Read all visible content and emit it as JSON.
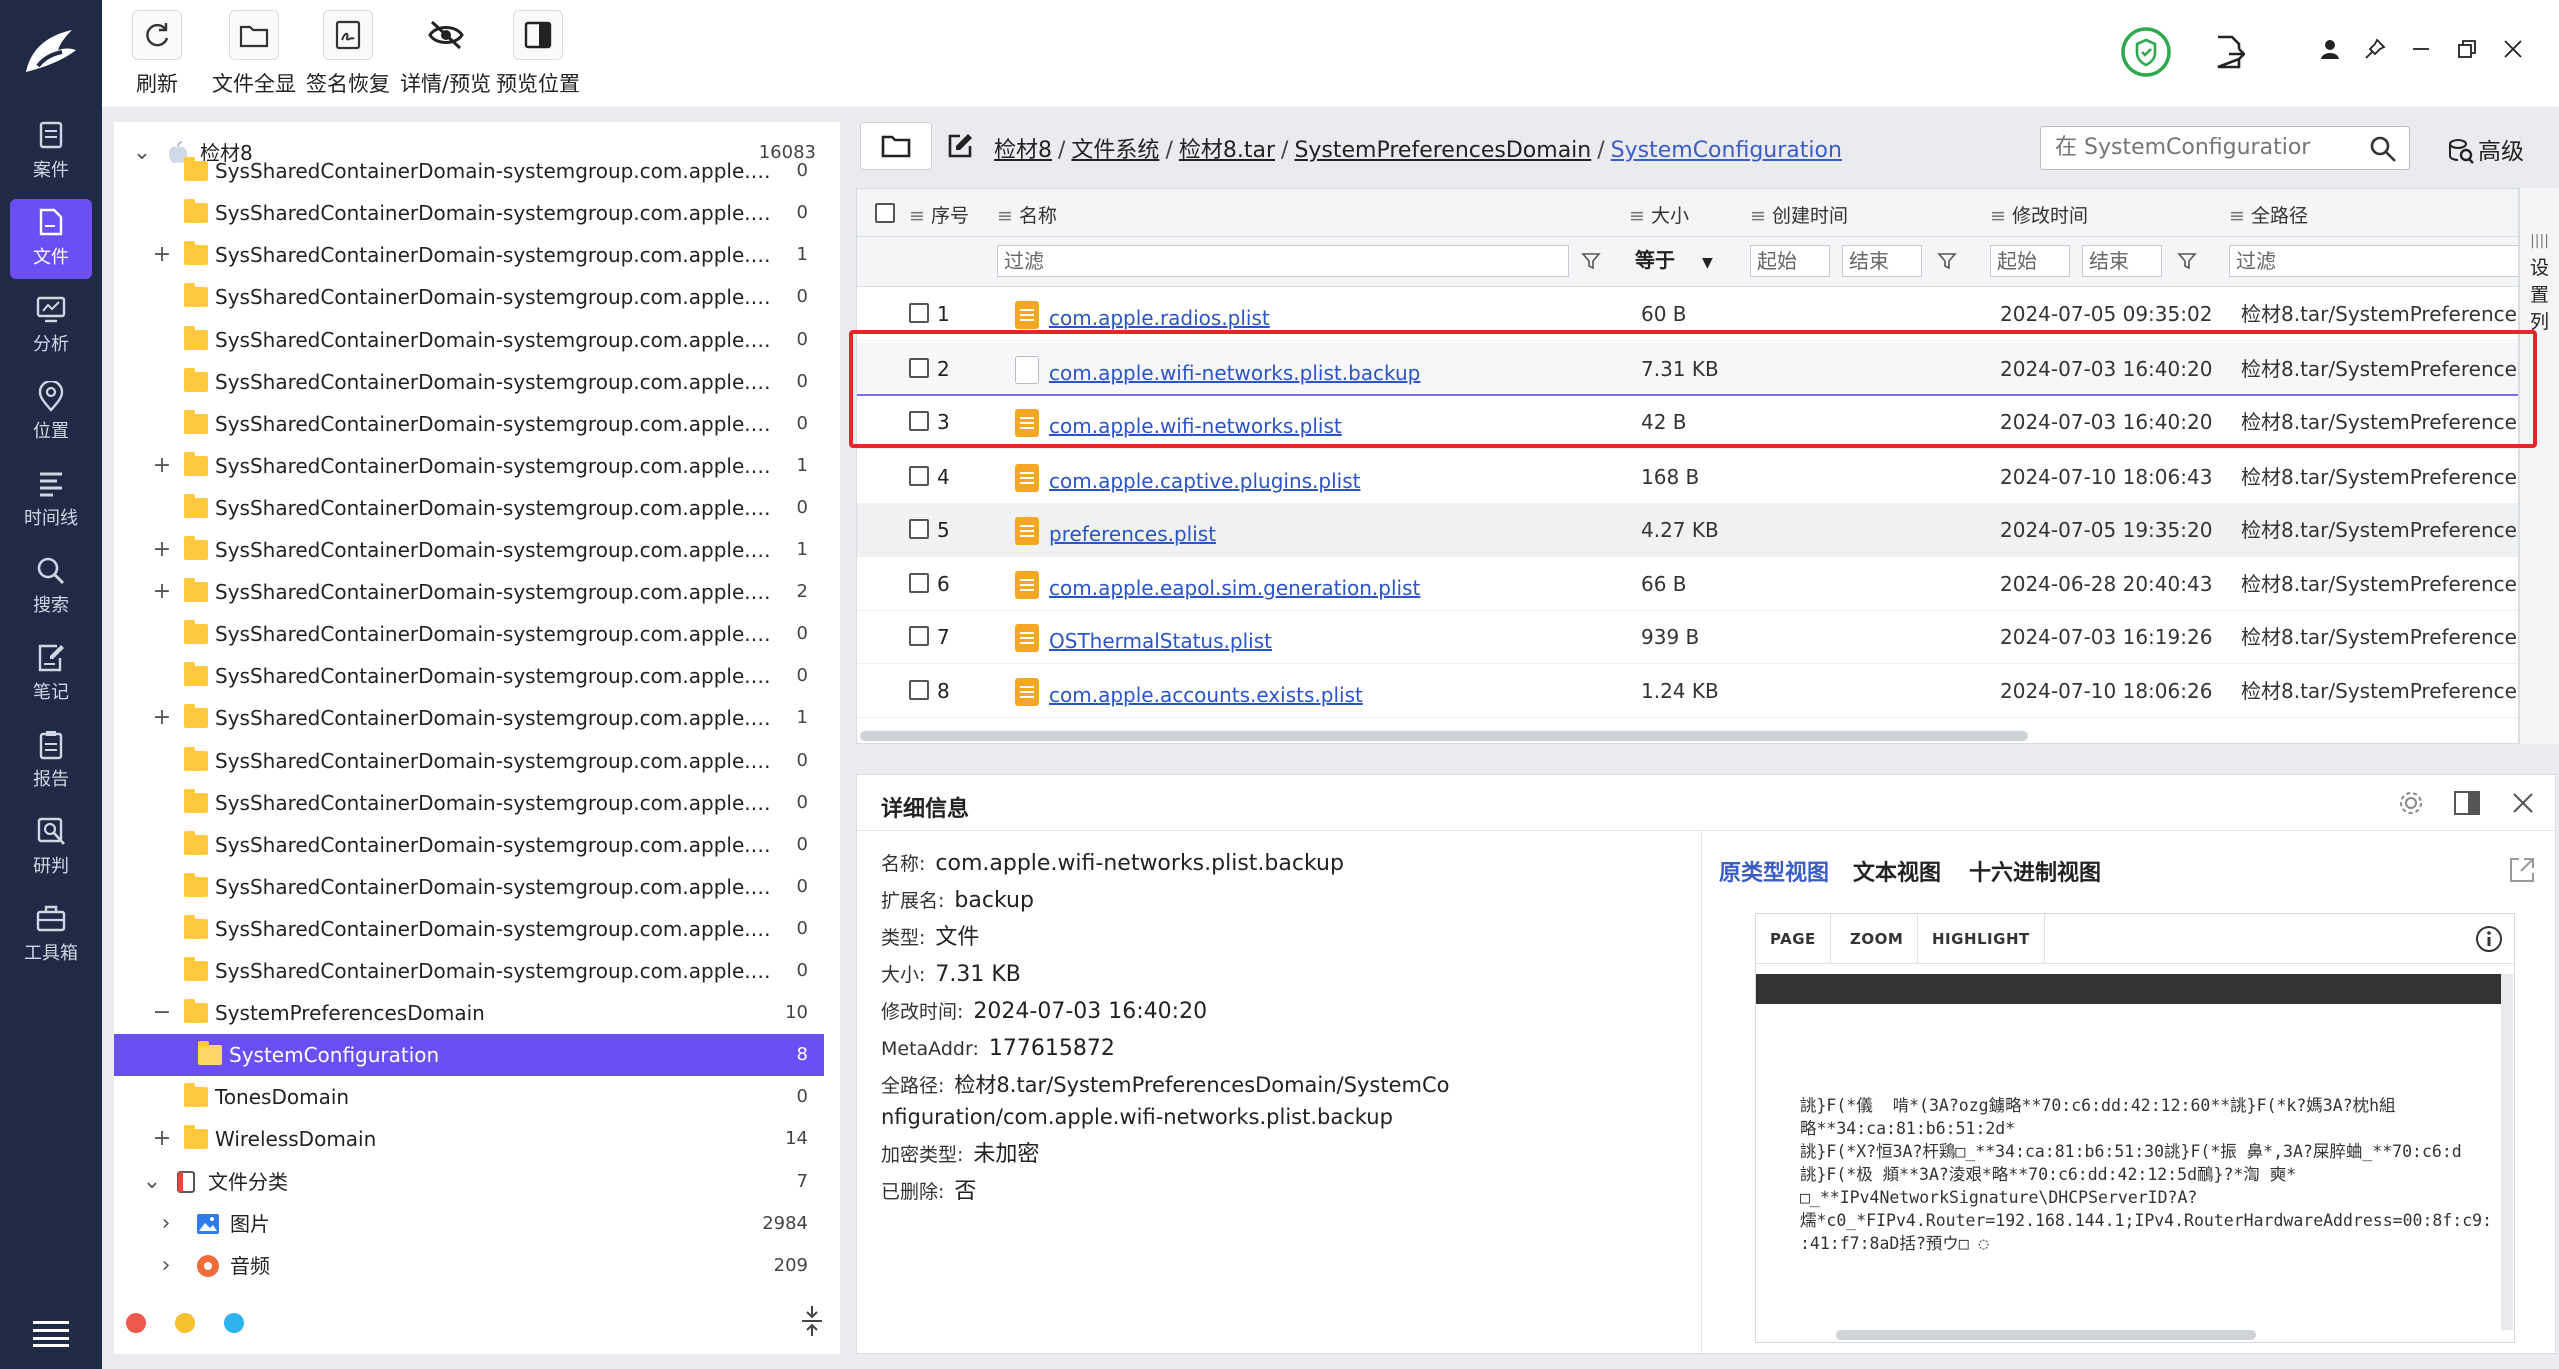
{
  "nav": {
    "items": [
      {
        "label": "案件",
        "icon": "case-icon"
      },
      {
        "label": "文件",
        "icon": "file-icon"
      },
      {
        "label": "分析",
        "icon": "analysis-icon"
      },
      {
        "label": "位置",
        "icon": "location-icon"
      },
      {
        "label": "时间线",
        "icon": "timeline-icon"
      },
      {
        "label": "搜索",
        "icon": "search-icon"
      },
      {
        "label": "笔记",
        "icon": "note-icon"
      },
      {
        "label": "报告",
        "icon": "report-icon"
      },
      {
        "label": "研判",
        "icon": "judge-icon"
      },
      {
        "label": "工具箱",
        "icon": "toolbox-icon"
      }
    ],
    "active_index": 1
  },
  "toolbar": {
    "refresh": "刷新",
    "show_all_files": "文件全显",
    "signature_recovery": "签名恢复",
    "details_preview": "详情/预览",
    "preview_position": "预览位置"
  },
  "tree": {
    "root": {
      "label": "检材8",
      "count": "16083"
    },
    "rows": [
      {
        "label": "SysSharedContainerDomain-systemgroup.com.apple.Devic...",
        "count": "0",
        "exp": ""
      },
      {
        "label": "SysSharedContainerDomain-systemgroup.com.apple.geod",
        "count": "0",
        "exp": ""
      },
      {
        "label": "SysSharedContainerDomain-systemgroup.com.apple.icloud...",
        "count": "1",
        "exp": "+"
      },
      {
        "label": "SysSharedContainerDomain-systemgroup.com.apple.icloud...",
        "count": "0",
        "exp": ""
      },
      {
        "label": "SysSharedContainerDomain-systemgroup.com.apple.icloud...",
        "count": "0",
        "exp": ""
      },
      {
        "label": "SysSharedContainerDomain-systemgroup.com.apple.lsd",
        "count": "0",
        "exp": ""
      },
      {
        "label": "SysSharedContainerDomain-systemgroup.com.apple.lsd.ico...",
        "count": "0",
        "exp": ""
      },
      {
        "label": "SysSharedContainerDomain-systemgroup.com.apple.lskdrl",
        "count": "1",
        "exp": "+"
      },
      {
        "label": "SysSharedContainerDomain-systemgroup.com.apple.media...",
        "count": "0",
        "exp": ""
      },
      {
        "label": "SysSharedContainerDomain-systemgroup.com.apple.media...",
        "count": "1",
        "exp": "+"
      },
      {
        "label": "SysSharedContainerDomain-systemgroup.com.apple.mobil...",
        "count": "2",
        "exp": "+"
      },
      {
        "label": "SysSharedContainerDomain-systemgroup.com.apple.mobil...",
        "count": "0",
        "exp": ""
      },
      {
        "label": "SysSharedContainerDomain-systemgroup.com.apple.nearb...",
        "count": "0",
        "exp": ""
      },
      {
        "label": "SysSharedContainerDomain-systemgroup.com.apple.nsurls...",
        "count": "1",
        "exp": "+"
      },
      {
        "label": "SysSharedContainerDomain-systemgroup.com.apple.onde...",
        "count": "0",
        "exp": ""
      },
      {
        "label": "SysSharedContainerDomain-systemgroup.com.apple.osana...",
        "count": "0",
        "exp": ""
      },
      {
        "label": "SysSharedContainerDomain-systemgroup.com.apple.Repor...",
        "count": "0",
        "exp": ""
      },
      {
        "label": "SysSharedContainerDomain-systemgroup.com.apple.share...",
        "count": "0",
        "exp": ""
      },
      {
        "label": "SysSharedContainerDomain-systemgroup.com.apple.Video...",
        "count": "0",
        "exp": ""
      },
      {
        "label": "SysSharedContainerDomain-systemgroup.com.apple.WiFiA...",
        "count": "0",
        "exp": ""
      },
      {
        "label": "SystemPreferencesDomain",
        "count": "10",
        "exp": "−"
      },
      {
        "label": "SystemConfiguration",
        "count": "8",
        "exp": "",
        "selected": true
      },
      {
        "label": "TonesDomain",
        "count": "0",
        "exp": ""
      },
      {
        "label": "WirelessDomain",
        "count": "14",
        "exp": "+"
      }
    ],
    "category": {
      "label": "文件分类",
      "count": "7"
    },
    "cat_items": [
      {
        "label": "图片",
        "count": "2984"
      },
      {
        "label": "音频",
        "count": "209"
      }
    ]
  },
  "breadcrumb": {
    "items": [
      "检材8",
      "文件系统",
      "检材8.tar",
      "SystemPreferencesDomain",
      "SystemConfiguration"
    ]
  },
  "search": {
    "placeholder": "在 SystemConfiguratior"
  },
  "advanced_label": "高级",
  "table": {
    "columns": {
      "index": "序号",
      "name": "名称",
      "size": "大小",
      "ctime": "创建时间",
      "mtime": "修改时间",
      "path": "全路径"
    },
    "filters": {
      "name": "过滤",
      "size_op": "等于",
      "ctime_start": "起始",
      "ctime_end": "结束",
      "mtime_start": "起始",
      "mtime_end": "结束",
      "path": "过滤"
    },
    "rows": [
      {
        "idx": "1",
        "name": "com.apple.radios.plist",
        "size": "60 B",
        "mtime": "2024-07-05 09:35:02",
        "path": "检材8.tar/SystemPreferencesD",
        "icon": "plist"
      },
      {
        "idx": "2",
        "name": "com.apple.wifi-networks.plist.backup",
        "size": "7.31 KB",
        "mtime": "2024-07-03 16:40:20",
        "path": "检材8.tar/SystemPreferencesD",
        "icon": "blank"
      },
      {
        "idx": "3",
        "name": "com.apple.wifi-networks.plist",
        "size": "42 B",
        "mtime": "2024-07-03 16:40:20",
        "path": "检材8.tar/SystemPreferencesD",
        "icon": "plist"
      },
      {
        "idx": "4",
        "name": "com.apple.captive.plugins.plist",
        "size": "168 B",
        "mtime": "2024-07-10 18:06:43",
        "path": "检材8.tar/SystemPreferencesD",
        "icon": "plist"
      },
      {
        "idx": "5",
        "name": "preferences.plist",
        "size": "4.27 KB",
        "mtime": "2024-07-05 19:35:20",
        "path": "检材8.tar/SystemPreferencesD",
        "icon": "plist"
      },
      {
        "idx": "6",
        "name": "com.apple.eapol.sim.generation.plist",
        "size": "66 B",
        "mtime": "2024-06-28 20:40:43",
        "path": "检材8.tar/SystemPreferencesD",
        "icon": "plist"
      },
      {
        "idx": "7",
        "name": "OSThermalStatus.plist",
        "size": "939 B",
        "mtime": "2024-07-03 16:19:26",
        "path": "检材8.tar/SystemPreferencesD",
        "icon": "plist"
      },
      {
        "idx": "8",
        "name": "com.apple.accounts.exists.plist",
        "size": "1.24 KB",
        "mtime": "2024-07-10 18:06:26",
        "path": "检材8.tar/SystemPreferencesD",
        "icon": "plist"
      }
    ],
    "column_settings": "设置列"
  },
  "detail": {
    "title": "详细信息",
    "props": [
      {
        "k": "名称:",
        "v": "com.apple.wifi-networks.plist.backup"
      },
      {
        "k": "扩展名:",
        "v": "backup"
      },
      {
        "k": "类型:",
        "v": "文件"
      },
      {
        "k": "大小:",
        "v": "7.31 KB"
      },
      {
        "k": "修改时间:",
        "v": "2024-07-03 16:40:20"
      },
      {
        "k": "MetaAddr:",
        "v": "177615872"
      },
      {
        "k": "全路径:",
        "v": "检材8.tar/SystemPreferencesDomain/SystemConfiguration/com.apple.wifi-networks.plist.backup"
      },
      {
        "k": "加密类型:",
        "v": "未加密"
      },
      {
        "k": "已删除:",
        "v": "否"
      }
    ],
    "tabs": [
      "原类型视图",
      "文本视图",
      "十六进制视图"
    ],
    "viewer_toolbar": [
      "PAGE",
      "ZOOM",
      "HIGHLIGHT"
    ],
    "viewer_lines": [
      "誂}F(*儀  啃*(3A?ozg鐪略**70:c6:dd:42:12:60**誂}F(*k?媽3A?枕h組",
      "略**34:ca:81:b6:51:2d*",
      "誂}F(*X?恒3A?杆鶏□_**34:ca:81:b6:51:30誂}F(*振 鼻*,3A?屎脺蛐_**70:c6:d",
      "誂}F(*极 頫**3A?淩艰*略**70:c6:dd:42:12:5d鴯}?*渹 奭*",
      "□_**IPv4NetworkSignature\\DHCPServerID?A?",
      "燸*c0_*FIPv4.Router=192.168.144.1;IPv4.RouterHardwareAddress=00:8f:c9:",
      ":41:f7:8aD括?預ウ□ ◌"
    ]
  },
  "colors": {
    "accent": "#6c4ef5",
    "nav_bg": "#1f2a44",
    "link": "#2a55c8",
    "highlight_box": "#e8262a",
    "dot_red": "#f0584f",
    "dot_yellow": "#f6c02e",
    "dot_blue": "#2fb3f0"
  }
}
